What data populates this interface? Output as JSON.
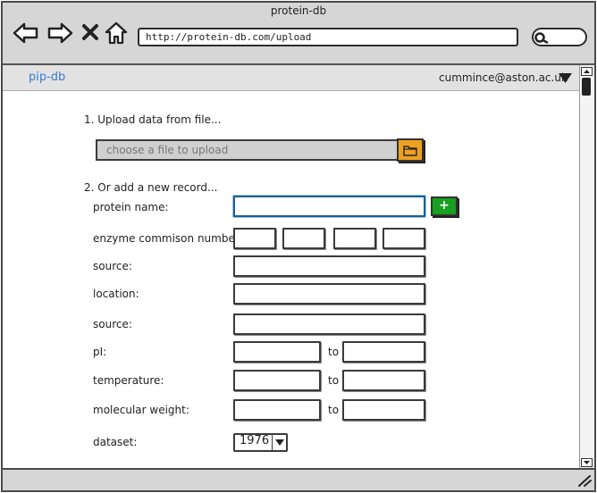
{
  "window": {
    "title": "protein-db"
  },
  "browser": {
    "url": "http://protein-db.com/upload",
    "search_placeholder": ""
  },
  "app_bar": {
    "brand": "pip-db",
    "user_email": "cummince@aston.ac.uk"
  },
  "upload_section": {
    "heading": "1. Upload data from file...",
    "file_placeholder": "choose a file to upload",
    "browse_icon": "folder-icon"
  },
  "record_section": {
    "heading": "2. Or add a new record...",
    "add_icon": "plus-icon",
    "add_label": "+",
    "labels": {
      "protein_name": "protein name:",
      "enzyme_number": "enzyme commison number:",
      "source": "source:",
      "location": "location:",
      "source2": "source:",
      "pi": "pI:",
      "temperature": "temperature:",
      "molecular_weight": "molecular weight:",
      "dataset": "dataset:"
    },
    "range_separator": "to",
    "dataset_value": "1976"
  },
  "colors": {
    "brand": "#3a7bd5",
    "browse_button": "#f0a020",
    "add_button": "#18a020",
    "focus_border": "#1b5e8e"
  }
}
